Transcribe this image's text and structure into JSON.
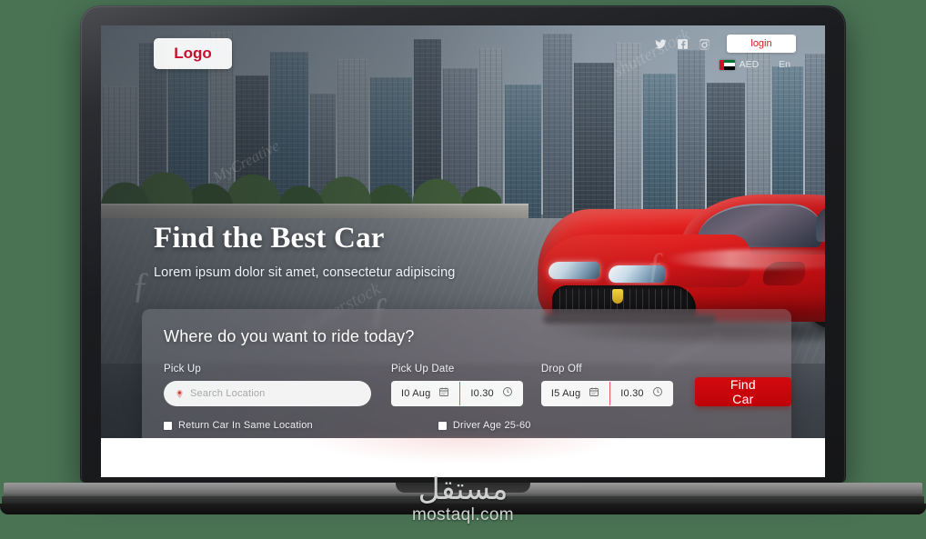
{
  "header": {
    "logo_text": "Logo",
    "social": [
      {
        "name": "twitter-icon",
        "label": "Twitter"
      },
      {
        "name": "facebook-icon",
        "label": "Facebook"
      },
      {
        "name": "instagram-icon",
        "label": "Instagram"
      }
    ],
    "login_label": "login",
    "currency_label": "AED",
    "language_label": "En",
    "flag": "uae-flag"
  },
  "hero": {
    "title": "Find the Best Car",
    "subtitle": "Lorem ipsum dolor sit amet, consectetur adipiscing",
    "watermarks": [
      "MyCreative",
      "shutterstock",
      "shutterstock",
      "shutterstock"
    ]
  },
  "search_panel": {
    "title": "Where do you want to ride today?",
    "pickup": {
      "label": "Pick Up",
      "placeholder": "Search Location",
      "value": ""
    },
    "pickup_date": {
      "label": "Pick Up Date",
      "date_value": "I0 Aug",
      "time_value": "I0.30"
    },
    "dropoff": {
      "label": "Drop Off",
      "date_value": "I5 Aug",
      "time_value": "I0.30"
    },
    "find_button_label": "Find Car",
    "checkboxes": [
      {
        "label": "Return Car In Same Location",
        "checked": false
      },
      {
        "label": "Driver Age 25-60",
        "checked": false
      }
    ]
  },
  "watermark": {
    "arabic": "مستقل",
    "latin": "mostaql.com"
  },
  "colors": {
    "brand_red": "#c8102e",
    "button_red": "#c40009",
    "panel_overlay": "rgba(130,125,132,0.45)",
    "page_background": "#4a7354"
  }
}
